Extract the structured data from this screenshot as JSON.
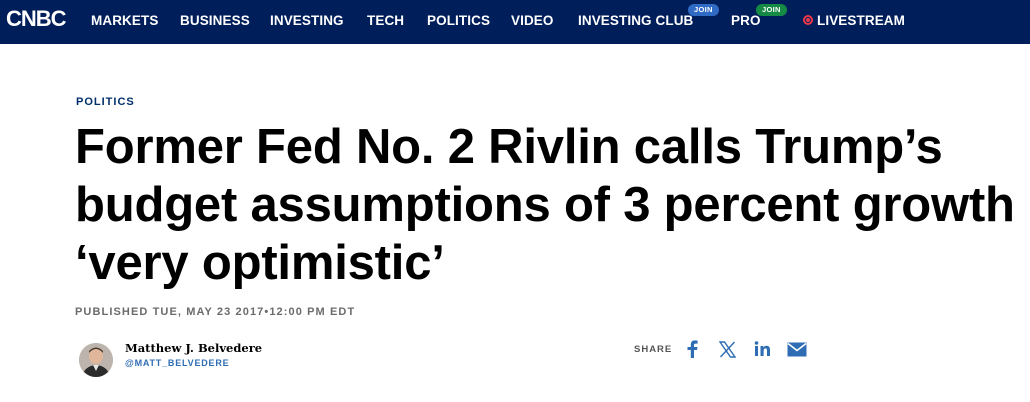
{
  "nav": {
    "logo": "CNBC",
    "items": [
      "MARKETS",
      "BUSINESS",
      "INVESTING",
      "TECH",
      "POLITICS",
      "VIDEO",
      "INVESTING CLUB",
      "PRO",
      "LIVESTREAM"
    ],
    "badges": {
      "investing_club": "JOIN",
      "pro": "JOIN"
    }
  },
  "article": {
    "category": "POLITICS",
    "headline": "Former Fed No. 2 Rivlin calls Trump’s budget assumptions of 3 percent growth ‘very optimistic’",
    "published": "PUBLISHED TUE, MAY 23 2017•12:00 PM EDT"
  },
  "author": {
    "name": "Matthew J. Belvedere",
    "handle": "@MATT_BELVEDERE"
  },
  "share": {
    "label": "SHARE",
    "icons": [
      "facebook-icon",
      "x-icon",
      "linkedin-icon",
      "email-icon"
    ]
  },
  "colors": {
    "nav_bg": "#001e5a",
    "category": "#002f6c",
    "link_blue": "#2e6db4",
    "live_red": "#e8374a",
    "join_blue": "#2f6ac4",
    "join_green": "#158a45"
  }
}
